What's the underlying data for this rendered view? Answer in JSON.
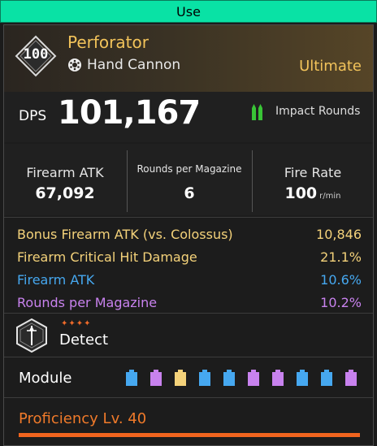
{
  "use_button": {
    "label": "Use"
  },
  "weapon": {
    "level_badge": "100",
    "name": "Perforator",
    "type": "Hand Cannon",
    "rarity": "Ultimate"
  },
  "dps": {
    "label": "DPS",
    "value": "101,167",
    "ammo_type": "Impact Rounds"
  },
  "stats": [
    {
      "label": "Firearm ATK",
      "value": "67,092",
      "unit": ""
    },
    {
      "label": "Rounds per Magazine",
      "value": "6",
      "unit": ""
    },
    {
      "label": "Fire Rate",
      "value": "100",
      "unit": "r/min"
    }
  ],
  "bonus_stats": [
    {
      "label": "Bonus Firearm ATK (vs. Colossus)",
      "value": "10,846",
      "color": "#f4d27a"
    },
    {
      "label": "Firearm Critical Hit Damage",
      "value": "21.1%",
      "color": "#f4d27a"
    },
    {
      "label": "Firearm ATK",
      "value": "10.6%",
      "color": "#46a8f0"
    },
    {
      "label": "Rounds per Magazine",
      "value": "10.2%",
      "color": "#c882ee"
    }
  ],
  "ability": {
    "stars": "✦✦✦✦",
    "name": "Detect"
  },
  "module": {
    "label": "Module",
    "slot_colors": [
      "#46a8f0",
      "#c882ee",
      "#f4d27a",
      "#46a8f0",
      "#46a8f0",
      "#c882ee",
      "#c882ee",
      "#46a8f0",
      "#46a8f0",
      "#c882ee"
    ]
  },
  "proficiency": {
    "label": "Proficiency Lv. 40",
    "progress": 1.0
  },
  "colors": {
    "accent_green": "#09e2a5",
    "gold": "#f2c35a",
    "orange": "#f0641e"
  }
}
